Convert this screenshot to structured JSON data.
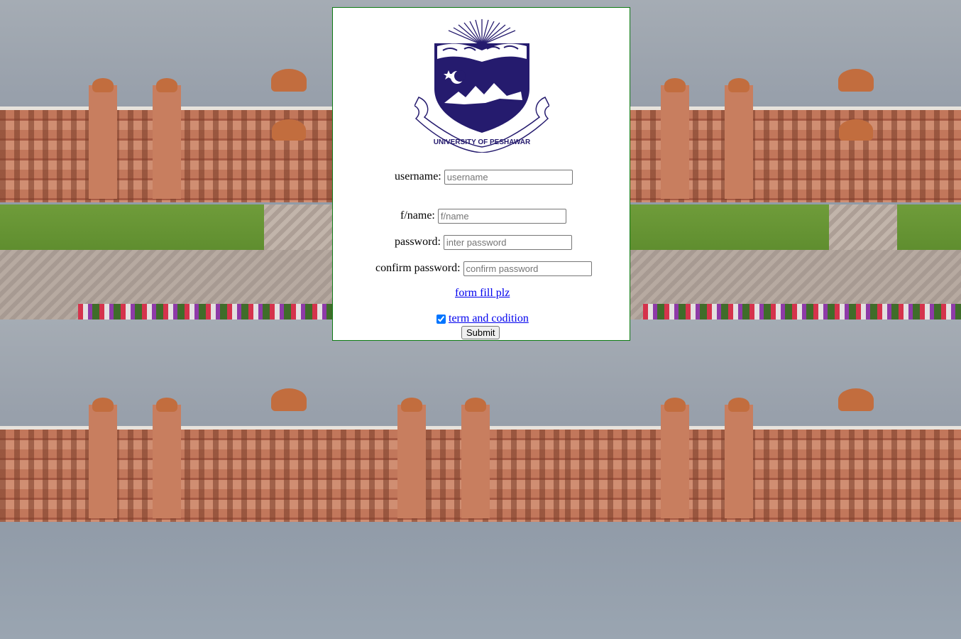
{
  "form": {
    "username_label": "username:",
    "username_placeholder": "username",
    "fname_label": "f/name:",
    "fname_placeholder": "f/name",
    "password_label": "password:",
    "password_placeholder": "inter password",
    "confirm_label": "confirm password:",
    "confirm_placeholder": "confirm password",
    "form_fill_link": "form fill plz",
    "terms_link": "term and codition",
    "terms_checked": true,
    "submit_label": "Submit"
  },
  "logo": {
    "icon": "university-of-peshawar-crest-icon",
    "text": "UNIVERSITY OF PESHAWAR",
    "colors": {
      "shield": "#251b6e",
      "accent": "#ffffff"
    }
  },
  "theme": {
    "panel_border": "#0c7a12",
    "link_color": "#0000ee"
  }
}
